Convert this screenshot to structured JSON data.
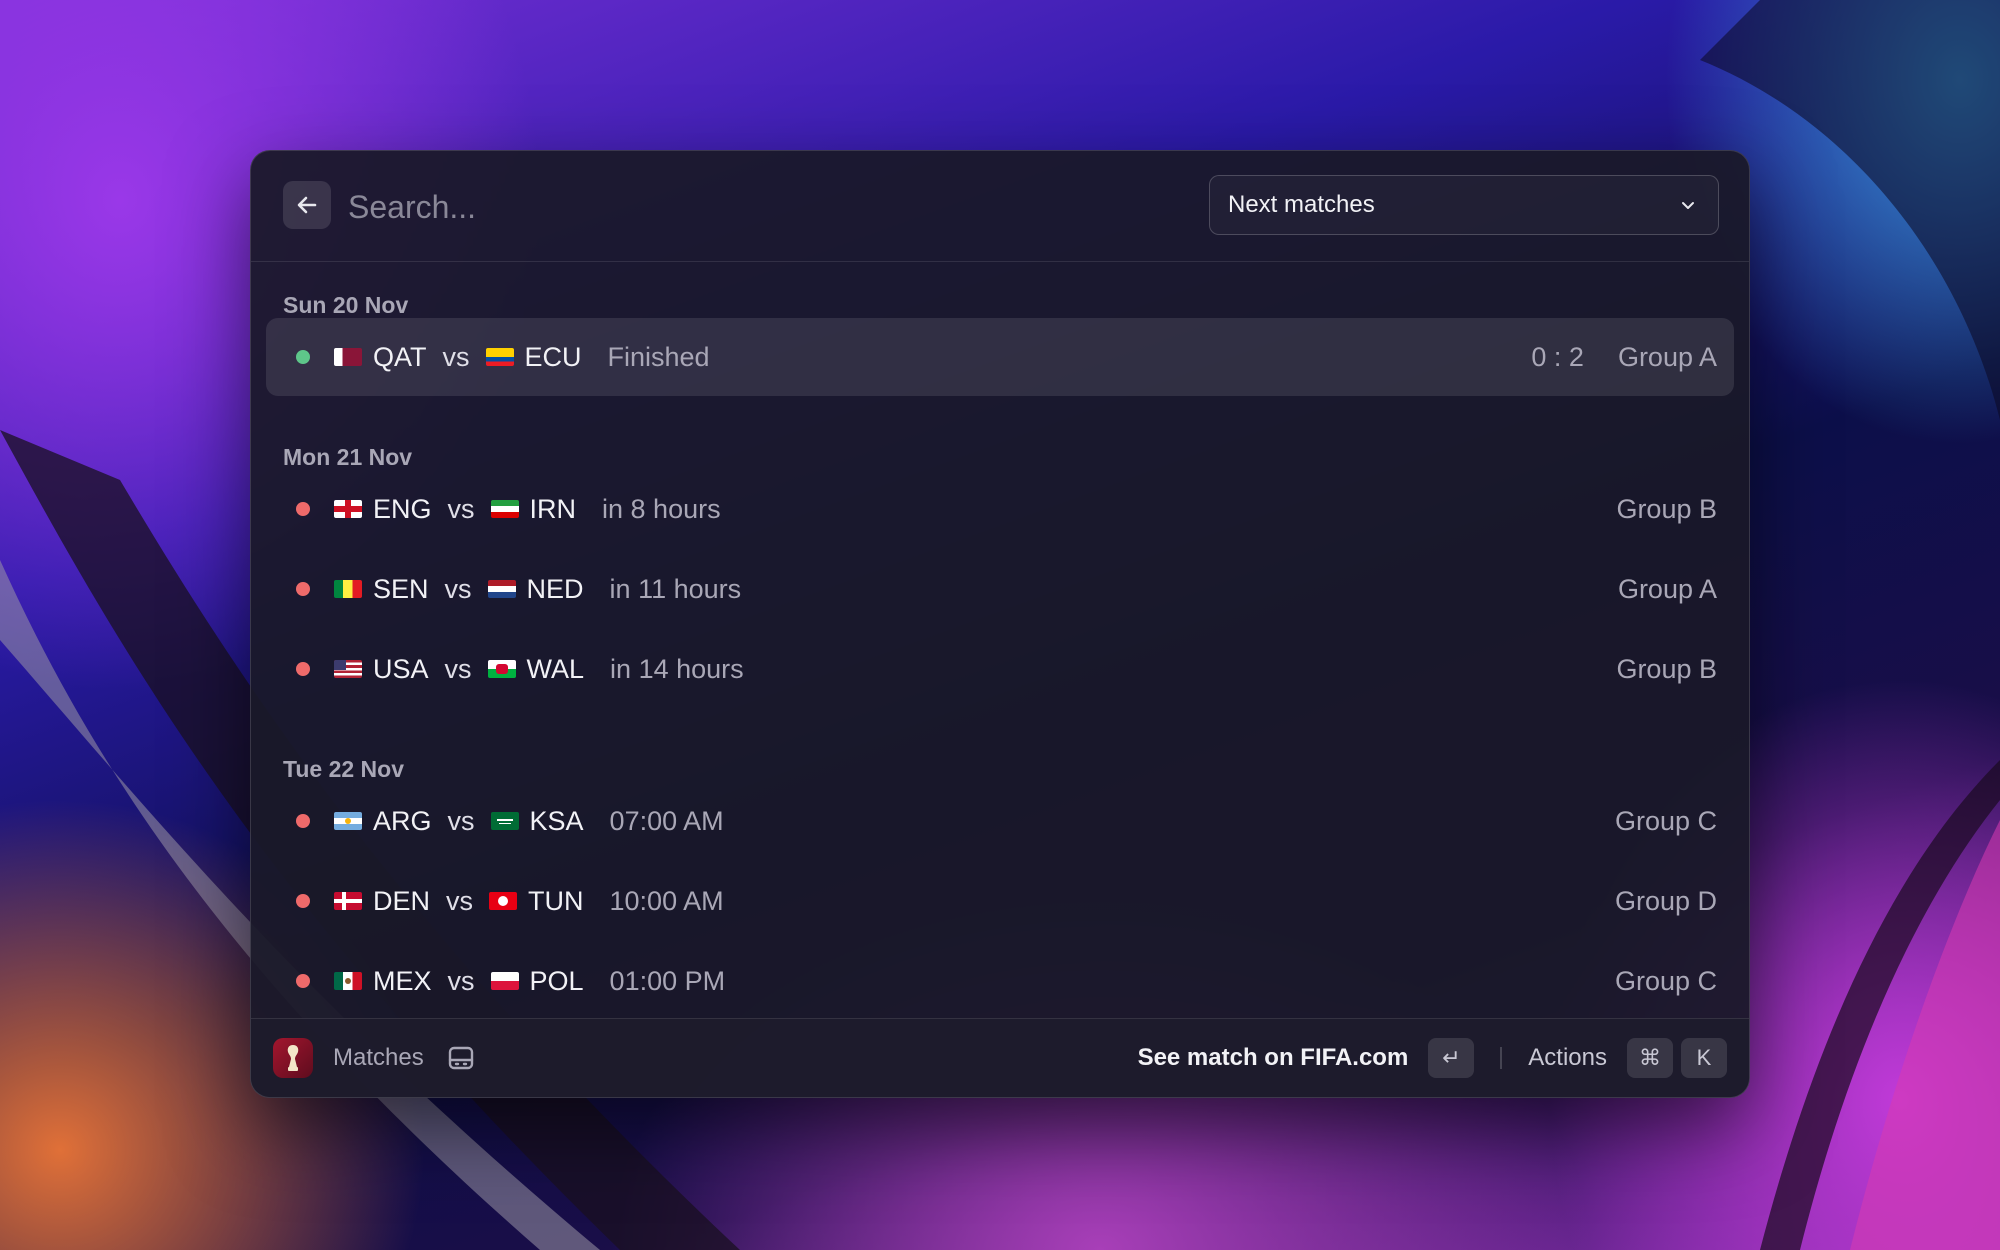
{
  "search": {
    "placeholder": "Search..."
  },
  "filter": {
    "selected": "Next matches"
  },
  "colors": {
    "finished_dot": "#5EC68A",
    "upcoming_dot": "#EE6A6A"
  },
  "sections": [
    {
      "date": "Sun 20 Nov",
      "matches": [
        {
          "home": "QAT",
          "away": "ECU",
          "status": "Finished",
          "score": "0 : 2",
          "group": "Group A",
          "state": "finished",
          "home_flag": "qatar-flag-icon",
          "away_flag": "ecuador-flag-icon"
        }
      ]
    },
    {
      "date": "Mon 21 Nov",
      "matches": [
        {
          "home": "ENG",
          "away": "IRN",
          "status": "in 8 hours",
          "score": "",
          "group": "Group B",
          "state": "upcoming",
          "home_flag": "england-flag-icon",
          "away_flag": "iran-flag-icon"
        },
        {
          "home": "SEN",
          "away": "NED",
          "status": "in 11 hours",
          "score": "",
          "group": "Group A",
          "state": "upcoming",
          "home_flag": "senegal-flag-icon",
          "away_flag": "netherlands-flag-icon"
        },
        {
          "home": "USA",
          "away": "WAL",
          "status": "in 14 hours",
          "score": "",
          "group": "Group B",
          "state": "upcoming",
          "home_flag": "usa-flag-icon",
          "away_flag": "wales-flag-icon"
        }
      ]
    },
    {
      "date": "Tue 22 Nov",
      "matches": [
        {
          "home": "ARG",
          "away": "KSA",
          "status": "07:00 AM",
          "score": "",
          "group": "Group C",
          "state": "upcoming",
          "home_flag": "argentina-flag-icon",
          "away_flag": "saudi-arabia-flag-icon"
        },
        {
          "home": "DEN",
          "away": "TUN",
          "status": "10:00 AM",
          "score": "",
          "group": "Group D",
          "state": "upcoming",
          "home_flag": "denmark-flag-icon",
          "away_flag": "tunisia-flag-icon"
        },
        {
          "home": "MEX",
          "away": "POL",
          "status": "01:00 PM",
          "score": "",
          "group": "Group C",
          "state": "upcoming",
          "home_flag": "mexico-flag-icon",
          "away_flag": "poland-flag-icon"
        }
      ]
    }
  ],
  "vs_label": "vs",
  "footer": {
    "title": "Matches",
    "primary_action": "See match on FIFA.com",
    "actions_label": "Actions",
    "enter_key": "↵",
    "cmd_key": "⌘",
    "k_key": "K"
  }
}
